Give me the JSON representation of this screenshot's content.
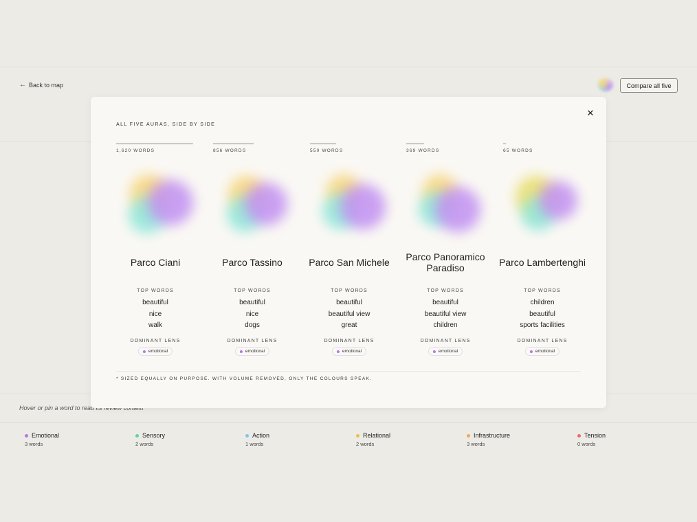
{
  "header": {
    "back_label": "Back to map",
    "compare_label": "Compare all five"
  },
  "hint": "Hover or pin a word to read its review context",
  "legend": [
    {
      "name": "Emotional",
      "count": "3 words",
      "color": "#b478e6"
    },
    {
      "name": "Sensory",
      "count": "2 words",
      "color": "#5fd3a6"
    },
    {
      "name": "Action",
      "count": "1 words",
      "color": "#7cc6ee"
    },
    {
      "name": "Relational",
      "count": "2 words",
      "color": "#e9c04a"
    },
    {
      "name": "Infrastructure",
      "count": "3 words",
      "color": "#f0a85a"
    },
    {
      "name": "Tension",
      "count": "0 words",
      "color": "#ee6a6a"
    }
  ],
  "modal": {
    "title": "ALL FIVE AURAS, SIDE BY SIDE",
    "close_icon": "close-icon",
    "top_words_label": "TOP WORDS",
    "dominant_lens_label": "DOMINANT LENS",
    "footnote": "* SIZED EQUALLY ON PURPOSE. WITH VOLUME REMOVED, ONLY THE COLOURS SPEAK.",
    "parks": [
      {
        "name": "Parco Ciani",
        "words_label": "1,620 WORDS",
        "word_share": 1.0,
        "top_words": [
          "beautiful",
          "nice",
          "walk"
        ],
        "lens": "emotional"
      },
      {
        "name": "Parco Tassino",
        "words_label": "856 WORDS",
        "word_share": 0.53,
        "top_words": [
          "beautiful",
          "nice",
          "dogs"
        ],
        "lens": "emotional"
      },
      {
        "name": "Parco San Michele",
        "words_label": "550 WORDS",
        "word_share": 0.34,
        "top_words": [
          "beautiful",
          "beautiful view",
          "great"
        ],
        "lens": "emotional"
      },
      {
        "name": "Parco Panoramico Paradiso",
        "words_label": "369 WORDS",
        "word_share": 0.23,
        "top_words": [
          "beautiful",
          "beautiful view",
          "children"
        ],
        "lens": "emotional"
      },
      {
        "name": "Parco Lambertenghi",
        "words_label": "65 WORDS",
        "word_share": 0.04,
        "top_words": [
          "children",
          "beautiful",
          "sports facilities"
        ],
        "lens": "emotional"
      }
    ]
  }
}
